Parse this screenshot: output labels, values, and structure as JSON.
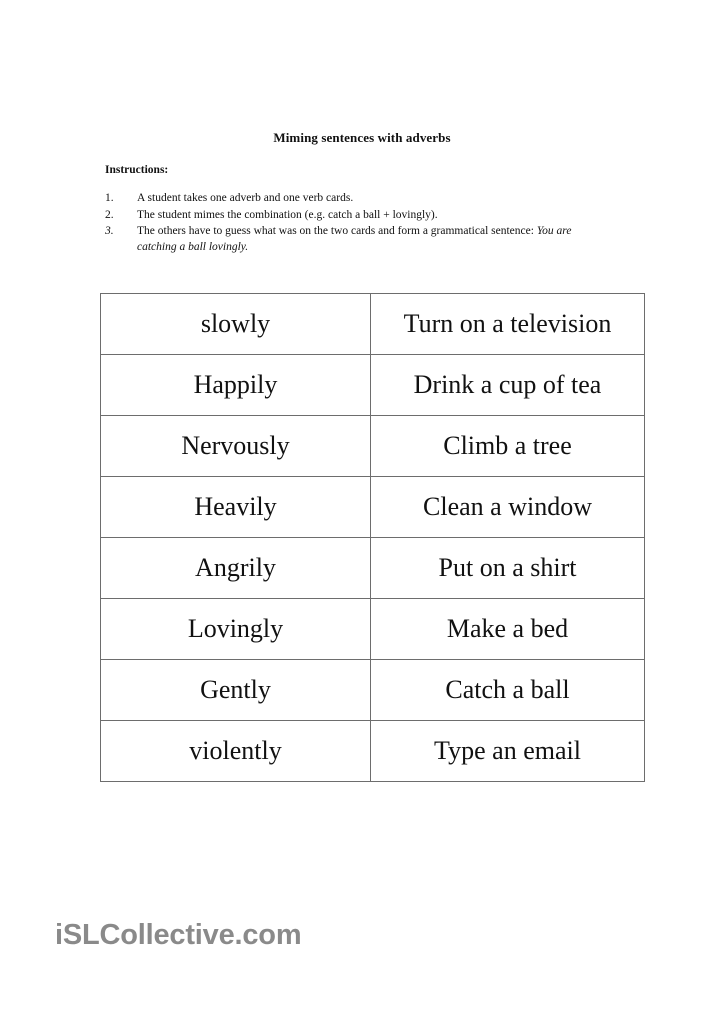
{
  "document": {
    "title": "Miming sentences with adverbs"
  },
  "instructions": {
    "heading": "Instructions:",
    "steps": [
      {
        "number": "1.",
        "number_italic": false,
        "text": "A student takes one adverb and one verb cards.",
        "emphasis": ""
      },
      {
        "number": "2.",
        "number_italic": false,
        "text": "The student mimes the combination (e.g. catch a ball + lovingly).",
        "emphasis": ""
      },
      {
        "number": "3.",
        "number_italic": true,
        "text": "The others have to guess what was on the two cards and form a grammatical sentence: ",
        "emphasis": "You are catching a ball lovingly."
      }
    ]
  },
  "cards_table": {
    "columns": [
      "adverb",
      "verb_phrase"
    ],
    "rows": [
      {
        "adverb": "slowly",
        "verb_phrase": "Turn on a television"
      },
      {
        "adverb": "Happily",
        "verb_phrase": "Drink a cup of tea"
      },
      {
        "adverb": "Nervously",
        "verb_phrase": "Climb a tree"
      },
      {
        "adverb": "Heavily",
        "verb_phrase": "Clean a window"
      },
      {
        "adverb": "Angrily",
        "verb_phrase": "Put on a shirt"
      },
      {
        "adverb": "Lovingly",
        "verb_phrase": "Make a bed"
      },
      {
        "adverb": "Gently",
        "verb_phrase": "Catch a ball"
      },
      {
        "adverb": "violently",
        "verb_phrase": "Type an email"
      }
    ]
  },
  "footer": {
    "logo_text": "iSLCollective.com",
    "logo_color": "#8a8a8a"
  },
  "colors": {
    "page_background": "#ffffff",
    "text": "#111111",
    "table_border": "#6d6d6d"
  }
}
